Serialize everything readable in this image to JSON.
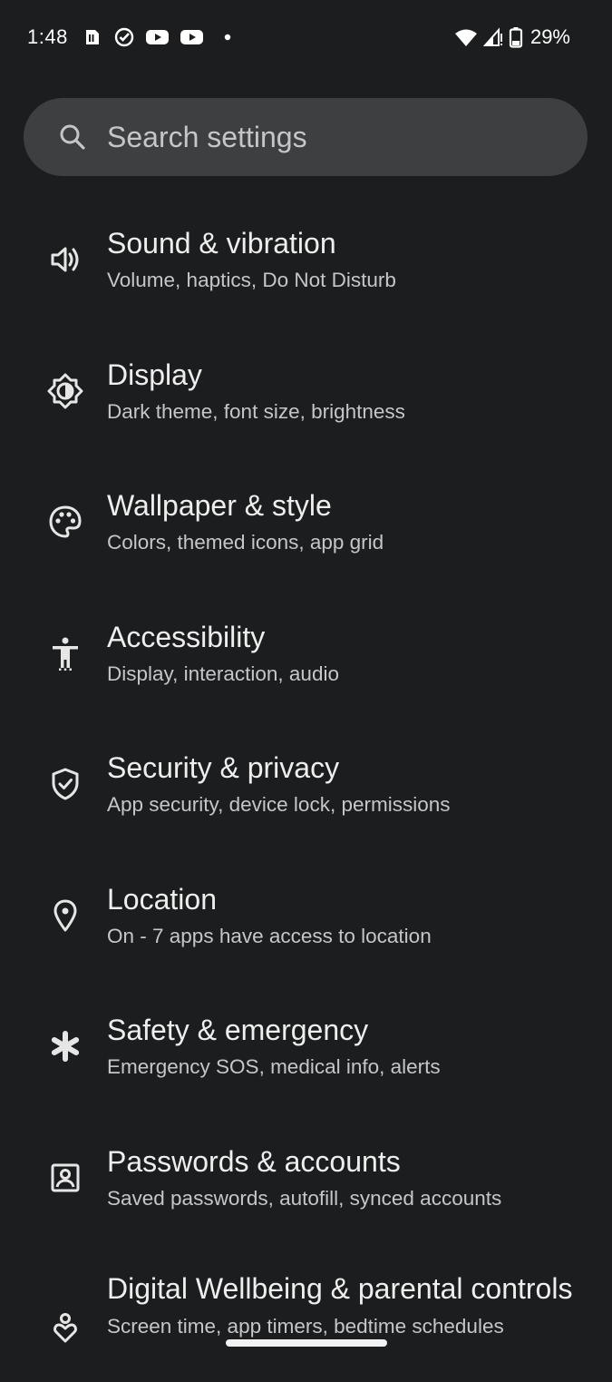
{
  "status_bar": {
    "time": "1:48",
    "battery_percent": "29%",
    "left_icons": [
      "sim-card-icon",
      "check-circle-icon",
      "youtube-icon",
      "youtube-icon",
      "dot-icon"
    ],
    "right_icons": [
      "wifi-icon",
      "signal-icon",
      "battery-icon"
    ]
  },
  "search": {
    "placeholder": "Search settings"
  },
  "settings": {
    "items": [
      {
        "icon": "volume-icon",
        "title": "Sound & vibration",
        "subtitle": "Volume, haptics, Do Not Disturb"
      },
      {
        "icon": "brightness-icon",
        "title": "Display",
        "subtitle": "Dark theme, font size, brightness"
      },
      {
        "icon": "palette-icon",
        "title": "Wallpaper & style",
        "subtitle": "Colors, themed icons, app grid"
      },
      {
        "icon": "accessibility-icon",
        "title": "Accessibility",
        "subtitle": "Display, interaction, audio"
      },
      {
        "icon": "shield-check-icon",
        "title": "Security & privacy",
        "subtitle": "App security, device lock, permissions"
      },
      {
        "icon": "location-pin-icon",
        "title": "Location",
        "subtitle": "On - 7 apps have access to location"
      },
      {
        "icon": "asterisk-icon",
        "title": "Safety & emergency",
        "subtitle": "Emergency SOS, medical info, alerts"
      },
      {
        "icon": "account-box-icon",
        "title": "Passwords & accounts",
        "subtitle": "Saved passwords, autofill, synced accounts"
      },
      {
        "icon": "wellbeing-icon",
        "title": "Digital Wellbeing & parental controls",
        "subtitle": "Screen time, app timers, bedtime schedules"
      }
    ]
  },
  "colors": {
    "background": "#1c1d1e",
    "search_bar": "#3d3f40",
    "title_text": "#eeeeee",
    "subtitle_text": "#c4c7c8"
  }
}
